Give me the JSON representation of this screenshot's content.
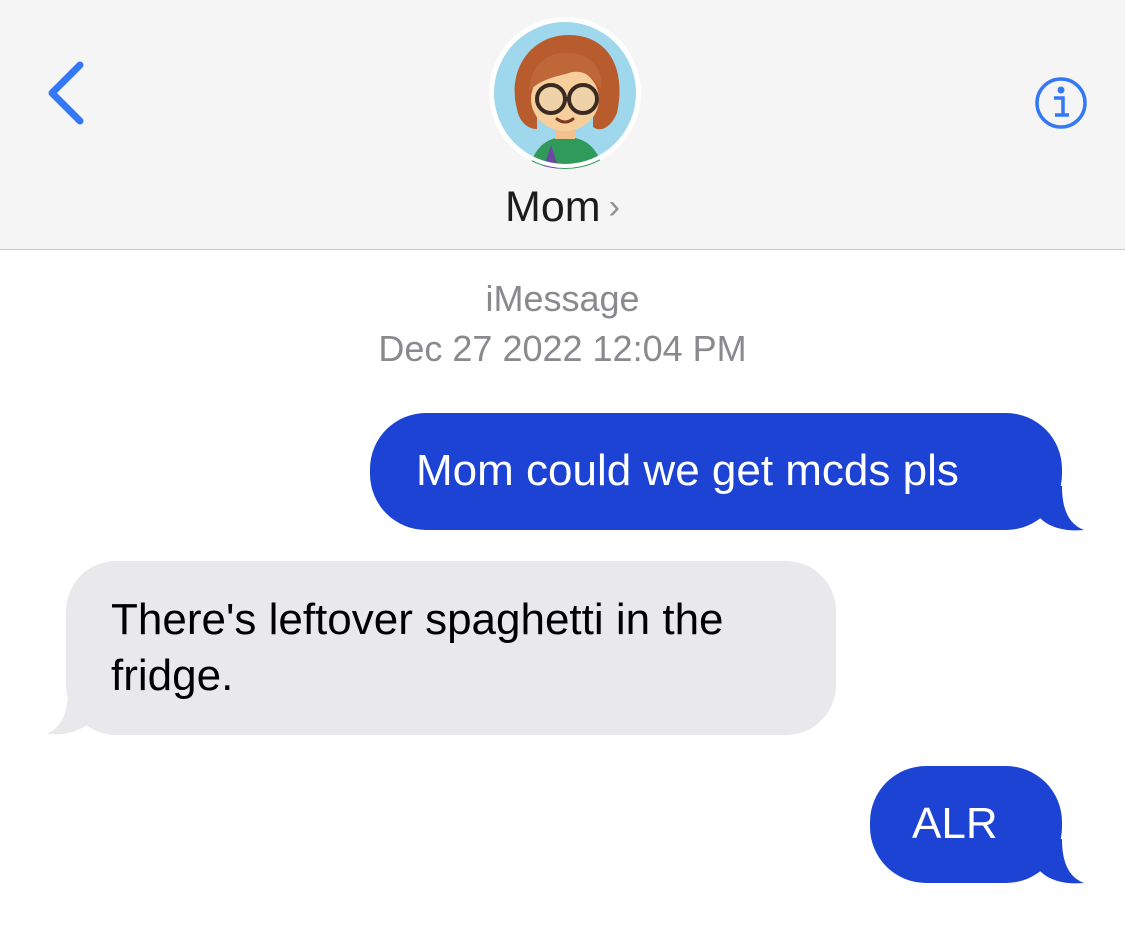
{
  "header": {
    "contact_name": "Mom",
    "chevron": "›",
    "back_icon": "chevron-left-icon",
    "info_icon": "info-circle-icon",
    "accent_color": "#3478f6"
  },
  "meta": {
    "service": "iMessage",
    "timestamp": "Dec 27 2022 12:04 PM"
  },
  "messages": [
    {
      "direction": "sent",
      "text": "Mom could we get mcds pls"
    },
    {
      "direction": "received",
      "text": "There's leftover spaghetti in the fridge."
    },
    {
      "direction": "sent",
      "text": "ALR"
    }
  ],
  "colors": {
    "sent_bubble": "#1c43d4",
    "received_bubble": "#e9e9eb",
    "header_bg": "#f5f5f5",
    "meta_text": "#8a8a8e"
  }
}
